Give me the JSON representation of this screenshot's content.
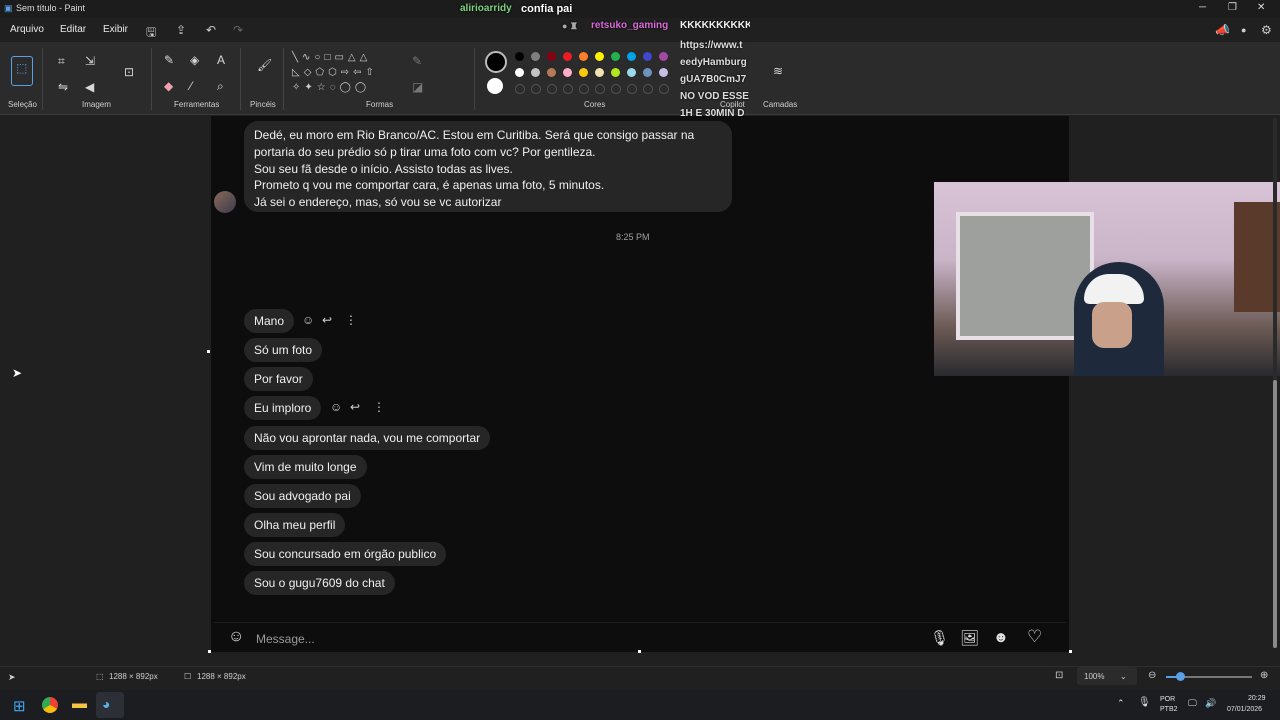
{
  "window": {
    "title": "Sem título - Paint",
    "controls": [
      "─",
      "❐",
      "✕"
    ]
  },
  "menu": [
    "Arquivo",
    "Editar",
    "Exibir"
  ],
  "ribbon": {
    "groups": [
      "Seleção",
      "Imagem",
      "Ferramentas",
      "Pincéis",
      "Formas",
      "Cores",
      "Copilot",
      "Camadas"
    ],
    "colors_row1": [
      "#000000",
      "#7f7f7f",
      "#880015",
      "#ed1c24",
      "#ff7f27",
      "#fff200",
      "#22b14c",
      "#00a2e8",
      "#3f48cc",
      "#a349a4"
    ],
    "colors_row2": [
      "#ffffff",
      "#c3c3c3",
      "#b97a57",
      "#ffaec9",
      "#ffc90e",
      "#efe4b0",
      "#b5e61d",
      "#99d9ea",
      "#7092be",
      "#c8bfe7"
    ]
  },
  "stream_overlay": {
    "user1": "alirioarridy",
    "msg1": "confia pai",
    "user2": "retsuko_gaming",
    "msg2": "KKKKKKKKKK",
    "lines": [
      "https://www.t",
      "eedyHamburg",
      "gUA7B0CmJ7",
      "NO VOD ESSE",
      "1H E 30MIN D"
    ]
  },
  "chat": {
    "long_message": [
      "Dedé, eu moro em Rio Branco/AC. Estou em Curitiba. Será que consigo passar na",
      "portaria do seu prédio só p tirar uma foto com vc? Por gentileza.",
      "Sou seu fã desde o início. Assisto todas as lives.",
      "Prometo q vou me comportar cara, é apenas uma foto, 5 minutos.",
      "Já sei o endereço, mas, só vou se vc autorizar"
    ],
    "timestamp": "8:25 PM",
    "messages": [
      "Mano",
      "Só um foto",
      "Por favor",
      "Eu imploro",
      "Não vou aprontar nada, vou me comportar",
      "Vim de muito longe",
      "Sou advogado pai",
      "Olha meu perfil",
      "Sou concursado em órgão publico",
      "Sou o gugu7609 do chat"
    ],
    "composer_placeholder": "Message..."
  },
  "statusbar": {
    "selection_size": "1288 × 892px",
    "canvas_size": "1288 × 892px",
    "zoom": "100%"
  },
  "taskbar": {
    "lang_top": "POR",
    "lang_bottom": "PTB2",
    "time": "20:29",
    "date": "07/01/2026"
  }
}
